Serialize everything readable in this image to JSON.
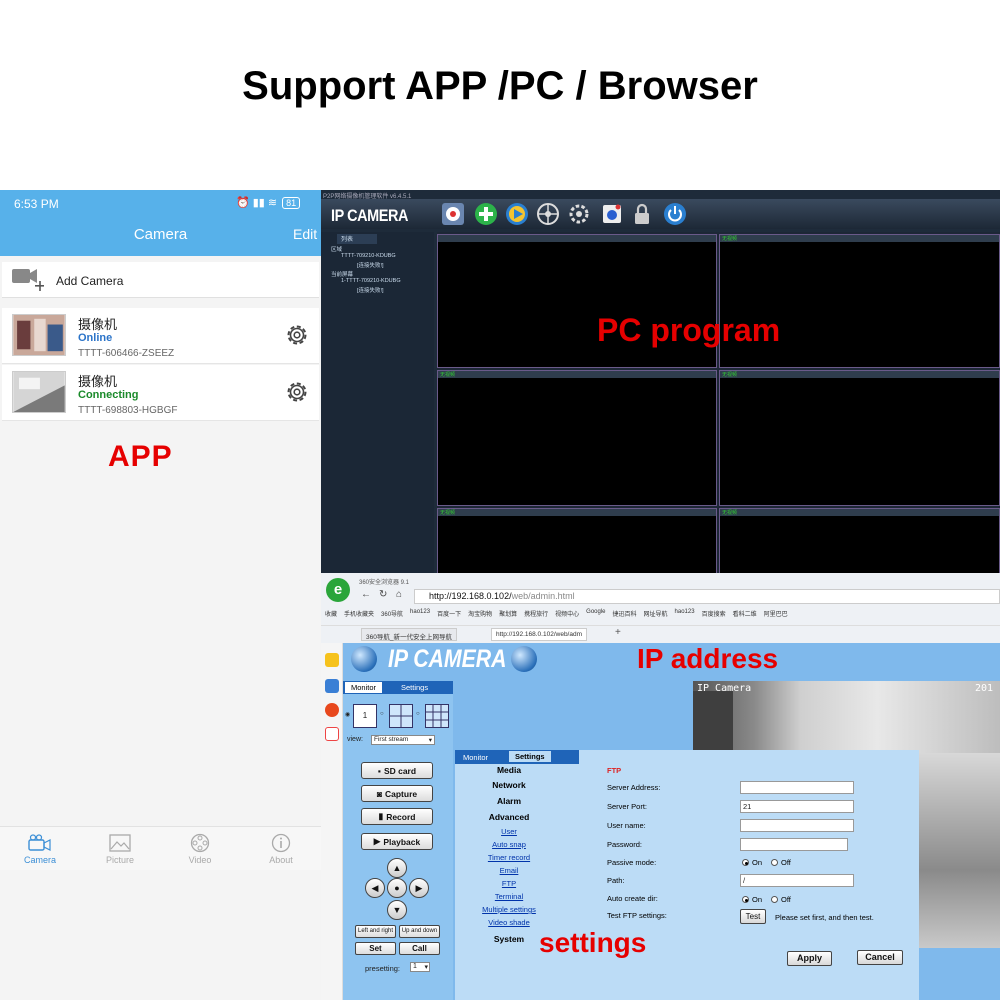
{
  "banner": "Support APP /PC / Browser",
  "app": {
    "time": "6:53 PM",
    "status_icons": "⏰ ▮▮ ≋",
    "battery": "81",
    "title": "Camera",
    "edit": "Edit",
    "add_camera": "Add Camera",
    "cameras": [
      {
        "name": "摄像机",
        "status": "Online",
        "status_color": "#2a73c8",
        "id": "TTTT-606466-ZSEEZ"
      },
      {
        "name": "摄像机",
        "status": "Connecting",
        "status_color": "#1a8a2a",
        "id": "TTTT-698803-HGBGF"
      }
    ],
    "label": "APP",
    "nav": [
      {
        "label": "Camera",
        "icon": "camera-icon"
      },
      {
        "label": "Picture",
        "icon": "picture-icon"
      },
      {
        "label": "Video",
        "icon": "video-icon"
      },
      {
        "label": "About",
        "icon": "info-icon"
      }
    ]
  },
  "pc": {
    "window_title": "P2P网络摄像机管理软件 v6.4.5.1",
    "logo": "IP CAMERA",
    "side_tab": "列表",
    "tree": [
      "区域",
      "TTTT-709210-KDUBG",
      "[连接失败!]",
      "当前屏幕",
      "1-TTTT-709210-KDUBG",
      "[连接失败!]"
    ],
    "cell_label": "无视频",
    "label": "PC program"
  },
  "browser": {
    "name": "360安全浏览器 9.1",
    "url_prefix": "http://192.168.0.102/",
    "url_path": "web/admin.html",
    "bookmarks": [
      "收藏",
      "手机收藏夹",
      "360导航",
      "hao123",
      "百度一下",
      "淘宝购物",
      "聚划算",
      "携程旅行",
      "视频中心",
      "Google",
      "捷迅百科",
      "网址导航",
      "hao123",
      "百度搜索",
      "看科二维",
      "阿里巴巴"
    ],
    "tabs": [
      "360导航_新一代安全上网导航",
      "http://192.168.0.102/web/adm"
    ],
    "web_title": "IP CAMERA",
    "ip_label": "IP address",
    "monitor_tab": "Monitor",
    "settings_tab": "Settings",
    "preset_num": "1",
    "view_label": "view:",
    "view_value": "First stream",
    "buttons": [
      "SD card",
      "Capture",
      "Record",
      "Playback"
    ],
    "ptz_small": [
      "Left and right",
      "Up and down",
      "Set",
      "Call"
    ],
    "presetting_label": "presetting:",
    "presetting_value": "1",
    "cam_text": "IP Camera",
    "cam_date": "201",
    "menu_tabs": [
      "Monitor",
      "Settings"
    ],
    "menu": {
      "media": "Media",
      "network": "Network",
      "alarm": "Alarm",
      "advanced": "Advanced",
      "links": [
        "User",
        "Auto snap",
        "Timer record",
        "Email",
        "FTP",
        "Terminal",
        "Multiple settings",
        "Video shade"
      ],
      "system": "System"
    },
    "form": {
      "section": "FTP",
      "server_address": "Server Address:",
      "server_port": "Server Port:",
      "port_value": "21",
      "user_name": "User name:",
      "password": "Password:",
      "passive_mode": "Passive mode:",
      "path": "Path:",
      "path_value": "/",
      "auto_create": "Auto create dir:",
      "test_ftp": "Test FTP settings:",
      "on": "On",
      "off": "Off",
      "test": "Test",
      "hint": "Please set first, and then test.",
      "apply": "Apply",
      "cancel": "Cancel"
    },
    "settings_label": "settings"
  }
}
